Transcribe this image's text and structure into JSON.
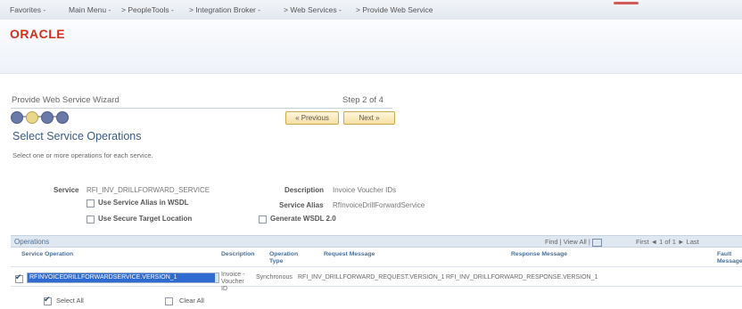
{
  "top_nav": {
    "favorites": "Favorites -",
    "main_menu": "Main Menu -",
    "peopletools": "> PeopleTools -",
    "integration_broker": "> Integration Broker -",
    "web_services": "> Web Services -",
    "provide_web_service": "> Provide Web Service"
  },
  "brand": {
    "logo_text": "ORACLE",
    "logo_color": "#D2301E"
  },
  "wizard": {
    "title": "Provide Web Service Wizard",
    "step_text": "Step 2 of 4",
    "steps_total": 4,
    "current_step": 2,
    "previous_label": "« Previous",
    "next_label": "Next »"
  },
  "page": {
    "title": "Select Service Operations",
    "instructions": "Select one or more operations for each service."
  },
  "service": {
    "service_label": "Service",
    "service_value": "RFI_INV_DRILLFORWARD_SERVICE",
    "description_label": "Description",
    "description_value": "Invoice Voucher IDs",
    "service_alias_label": "Service Alias",
    "service_alias_value": "RfInvoiceDrillForwardService",
    "use_service_alias_label": "Use Service Alias in WSDL",
    "use_secure_target_label": "Use Secure Target Location",
    "generate_wsdl_label": "Generate WSDL 2.0"
  },
  "operations": {
    "title": "Operations",
    "find_view": "Find | View All |",
    "nav_text": "First ◄ 1 of 1 ► Last",
    "columns": {
      "service_operation": "Service Operation",
      "description": "Description",
      "operation_type": "Operation Type",
      "request_message": "Request Message",
      "response_message": "Response Message",
      "fault_message": "Fault Message"
    },
    "rows": [
      {
        "checked": true,
        "service_operation": "RFINVOICEDRILLFORWARDSERVICE.VERSION_1",
        "description": "Invoice - Voucher ID",
        "operation_type": "Synchronous",
        "request_message": "RFI_INV_DRILLFORWARD_REQUEST.VERSION_1",
        "response_message": "RFI_INV_DRILLFORWARD_RESPONSE.VERSION_1"
      }
    ]
  },
  "footer": {
    "select_all": "Select All",
    "clear_all": "Clear All"
  }
}
